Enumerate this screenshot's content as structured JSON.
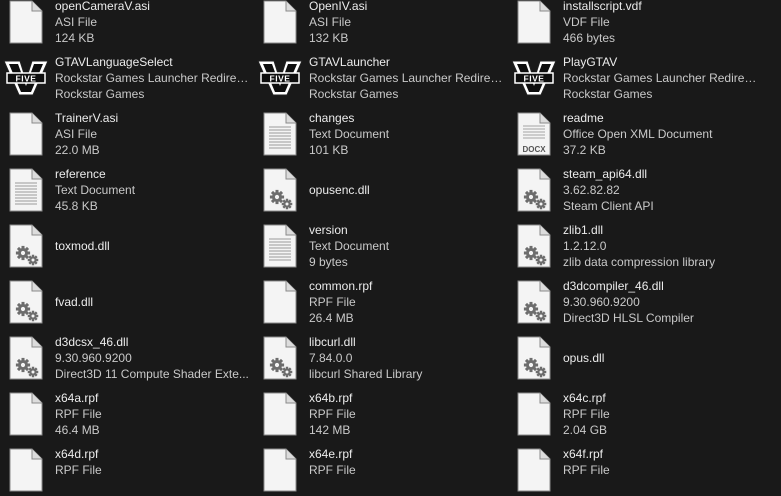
{
  "items": [
    {
      "name": "openCameraV.asi",
      "l2": "ASI File",
      "l3": "124 KB",
      "icon": "blank-file-icon"
    },
    {
      "name": "OpenIV.asi",
      "l2": "ASI File",
      "l3": "132 KB",
      "icon": "blank-file-icon"
    },
    {
      "name": "installscript.vdf",
      "l2": "VDF File",
      "l3": "466 bytes",
      "icon": "blank-file-icon"
    },
    {
      "name": "GTAVLanguageSelect",
      "l2": "Rockstar Games Launcher Redirec...",
      "l3": "Rockstar Games",
      "icon": "gta-five-logo-icon"
    },
    {
      "name": "GTAVLauncher",
      "l2": "Rockstar Games Launcher Redirec...",
      "l3": "Rockstar Games",
      "icon": "gta-five-logo-icon"
    },
    {
      "name": "PlayGTAV",
      "l2": "Rockstar Games Launcher Redirec...",
      "l3": "Rockstar Games",
      "icon": "gta-five-logo-icon"
    },
    {
      "name": "TrainerV.asi",
      "l2": "ASI File",
      "l3": "22.0 MB",
      "icon": "blank-file-icon"
    },
    {
      "name": "changes",
      "l2": "Text Document",
      "l3": "101 KB",
      "icon": "text-document-icon"
    },
    {
      "name": "readme",
      "l2": "Office Open XML Document",
      "l3": "37.2 KB",
      "icon": "docx-document-icon",
      "icon_label": "DOCX"
    },
    {
      "name": "reference",
      "l2": "Text Document",
      "l3": "45.8 KB",
      "icon": "text-document-icon"
    },
    {
      "name": "opusenc.dll",
      "l2": "",
      "l3": "",
      "icon": "dll-gear-icon"
    },
    {
      "name": "steam_api64.dll",
      "l2": "3.62.82.82",
      "l3": "Steam Client API",
      "icon": "dll-gear-icon"
    },
    {
      "name": "toxmod.dll",
      "l2": "",
      "l3": "",
      "icon": "dll-gear-icon"
    },
    {
      "name": "version",
      "l2": "Text Document",
      "l3": "9 bytes",
      "icon": "text-document-icon"
    },
    {
      "name": "zlib1.dll",
      "l2": "1.2.12.0",
      "l3": "zlib data compression library",
      "icon": "dll-gear-icon"
    },
    {
      "name": "fvad.dll",
      "l2": "",
      "l3": "",
      "icon": "dll-gear-icon"
    },
    {
      "name": "common.rpf",
      "l2": "RPF File",
      "l3": "26.4 MB",
      "icon": "blank-file-icon"
    },
    {
      "name": "d3dcompiler_46.dll",
      "l2": "9.30.960.9200",
      "l3": "Direct3D HLSL Compiler",
      "icon": "dll-gear-icon"
    },
    {
      "name": "d3dcsx_46.dll",
      "l2": "9.30.960.9200",
      "l3": "Direct3D 11 Compute Shader Exte...",
      "icon": "dll-gear-icon"
    },
    {
      "name": "libcurl.dll",
      "l2": "7.84.0.0",
      "l3": "libcurl Shared Library",
      "icon": "dll-gear-icon"
    },
    {
      "name": "opus.dll",
      "l2": "",
      "l3": "",
      "icon": "dll-gear-icon"
    },
    {
      "name": "x64a.rpf",
      "l2": "RPF File",
      "l3": "46.4 MB",
      "icon": "blank-file-icon"
    },
    {
      "name": "x64b.rpf",
      "l2": "RPF File",
      "l3": "142 MB",
      "icon": "blank-file-icon"
    },
    {
      "name": "x64c.rpf",
      "l2": "RPF File",
      "l3": "2.04 GB",
      "icon": "blank-file-icon"
    },
    {
      "name": "x64d.rpf",
      "l2": "RPF File",
      "l3": "",
      "icon": "blank-file-icon"
    },
    {
      "name": "x64e.rpf",
      "l2": "RPF File",
      "l3": "",
      "icon": "blank-file-icon"
    },
    {
      "name": "x64f.rpf",
      "l2": "RPF File",
      "l3": "",
      "icon": "blank-file-icon"
    }
  ],
  "colors": {
    "background": "#191919",
    "text_primary": "#ececec",
    "text_secondary": "#c9c9c9"
  }
}
